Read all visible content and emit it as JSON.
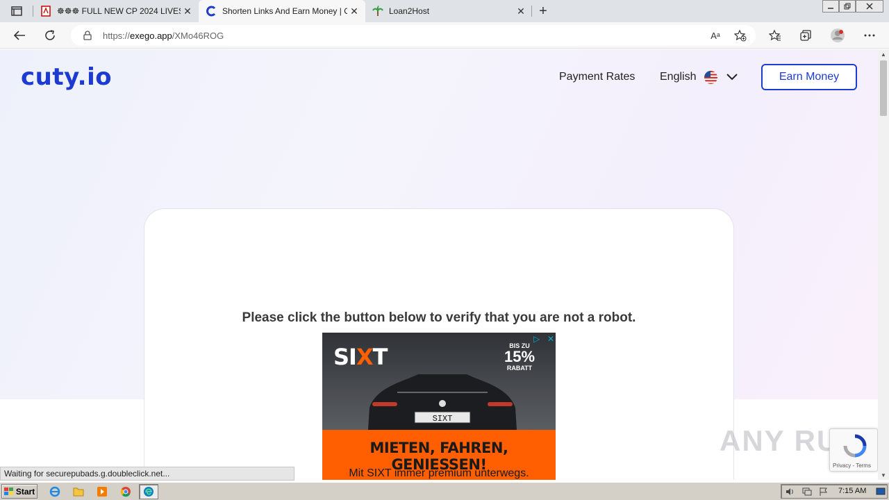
{
  "browser": {
    "tabs": [
      {
        "title": "☸☸☸ FULL NEW CP 2024 LIVES",
        "active": false
      },
      {
        "title": "Shorten Links And Earn Money | C",
        "active": true
      },
      {
        "title": "Loan2Host",
        "active": false
      }
    ],
    "new_tab_label": "+",
    "close_label": "✕",
    "url_prefix": "https://",
    "url_host": "exego.app",
    "url_path": "/XMo46ROG",
    "read_aloud_label": "Aᵃ"
  },
  "site": {
    "logo": "cuty.io",
    "nav": {
      "payment_rates": "Payment Rates",
      "language": "English",
      "earn_money": "Earn Money"
    },
    "verify_message": "Please click the button below to verify that you are not a robot."
  },
  "ad": {
    "brand": "SIXT",
    "badge_top": "BIS ZU",
    "badge_value": "15%",
    "badge_bottom": "RABATT",
    "plate": "SIXT",
    "headline": "MIETEN, FAHREN, GENIESSEN!",
    "subline": "Mit SIXT immer premium unterwegs.",
    "accent": "#ff5f00"
  },
  "recaptcha": {
    "links": "Privacy - Terms"
  },
  "watermark": "ANY RUN",
  "status_bar": "Waiting for securepubads.g.doubleclick.net...",
  "taskbar": {
    "start_label": "Start",
    "clock": "7:15 AM"
  },
  "colors": {
    "brand_blue": "#1d3bd1"
  }
}
